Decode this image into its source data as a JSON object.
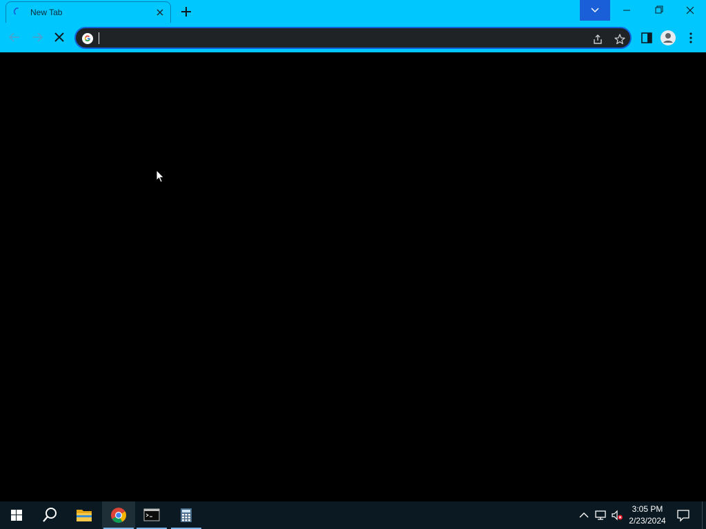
{
  "browser": {
    "tabs": [
      {
        "title": "New Tab",
        "loading": true
      }
    ],
    "omnibox": {
      "value": ""
    },
    "colors": {
      "frame": "#00c8ff",
      "omnibox_bg": "#1f2326",
      "omnibox_border": "#1260d8",
      "page_bg": "#000000"
    },
    "icons": {
      "tab_spinner": "loading-spinner-icon",
      "tab_close": "close-icon",
      "new_tab": "plus-icon",
      "tab_search": "chevron-down-icon",
      "back": "arrow-left-icon",
      "forward": "arrow-right-icon",
      "stop": "stop-icon",
      "site": "google-icon",
      "share": "share-icon",
      "bookmark": "star-icon",
      "side_panel": "side-panel-icon",
      "profile": "profile-icon",
      "menu": "kebab-menu-icon"
    }
  },
  "taskbar": {
    "apps": [
      {
        "name": "start",
        "icon": "windows-logo-icon"
      },
      {
        "name": "search",
        "icon": "search-icon"
      },
      {
        "name": "file-explorer",
        "icon": "folder-icon"
      },
      {
        "name": "chrome",
        "icon": "chrome-icon",
        "active": true
      },
      {
        "name": "command-prompt",
        "icon": "terminal-icon",
        "running": true
      },
      {
        "name": "calculator",
        "icon": "calculator-icon",
        "running": true
      }
    ],
    "tray": {
      "time": "3:05 PM",
      "date": "2/23/2024",
      "icons": [
        "chevron-up-icon",
        "network-icon",
        "volume-muted-icon",
        "notification-icon"
      ]
    },
    "colors": {
      "bg": "#0b1a22",
      "accent": "#7ab4e8"
    }
  }
}
